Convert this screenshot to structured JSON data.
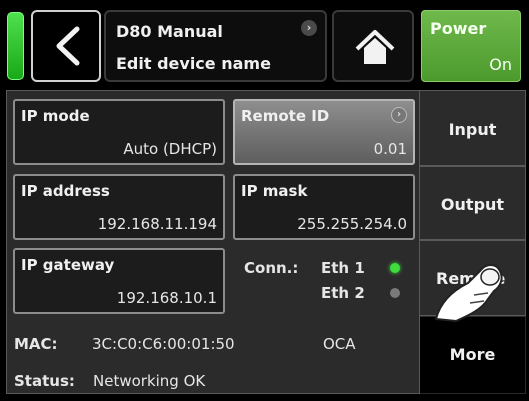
{
  "header": {
    "device_title": "D80 Manual",
    "subtitle": "Edit device name",
    "chevron_glyph": "›",
    "power": {
      "label": "Power",
      "value": "On"
    }
  },
  "fields": {
    "ip_mode": {
      "label": "IP mode",
      "value": "Auto (DHCP)"
    },
    "remote_id": {
      "label": "Remote ID",
      "value": "0.01"
    },
    "ip_address": {
      "label": "IP address",
      "value": "192.168.11.194"
    },
    "ip_mask": {
      "label": "IP mask",
      "value": "255.255.254.0"
    },
    "ip_gateway": {
      "label": "IP gateway",
      "value": "192.168.10.1"
    }
  },
  "connection": {
    "label": "Conn.:",
    "eth1": {
      "label": "Eth 1",
      "led_color": "#3fdc3f"
    },
    "eth2": {
      "label": "Eth 2",
      "led_color": "#7a7a7a"
    }
  },
  "info": {
    "mac_label": "MAC:",
    "mac_value": "3C:C0:C6:00:01:50",
    "protocol": "OCA",
    "status_label": "Status:",
    "status_value": "Networking OK"
  },
  "tabs": {
    "input": "Input",
    "output": "Output",
    "remote": "Remote",
    "more": "More"
  },
  "colors": {
    "status_led": "#2fc82f",
    "power_bg": "#5aa83a"
  },
  "icons": [
    "back-arrow-icon",
    "chevron-right-icon",
    "home-icon",
    "pointing-hand-icon"
  ]
}
